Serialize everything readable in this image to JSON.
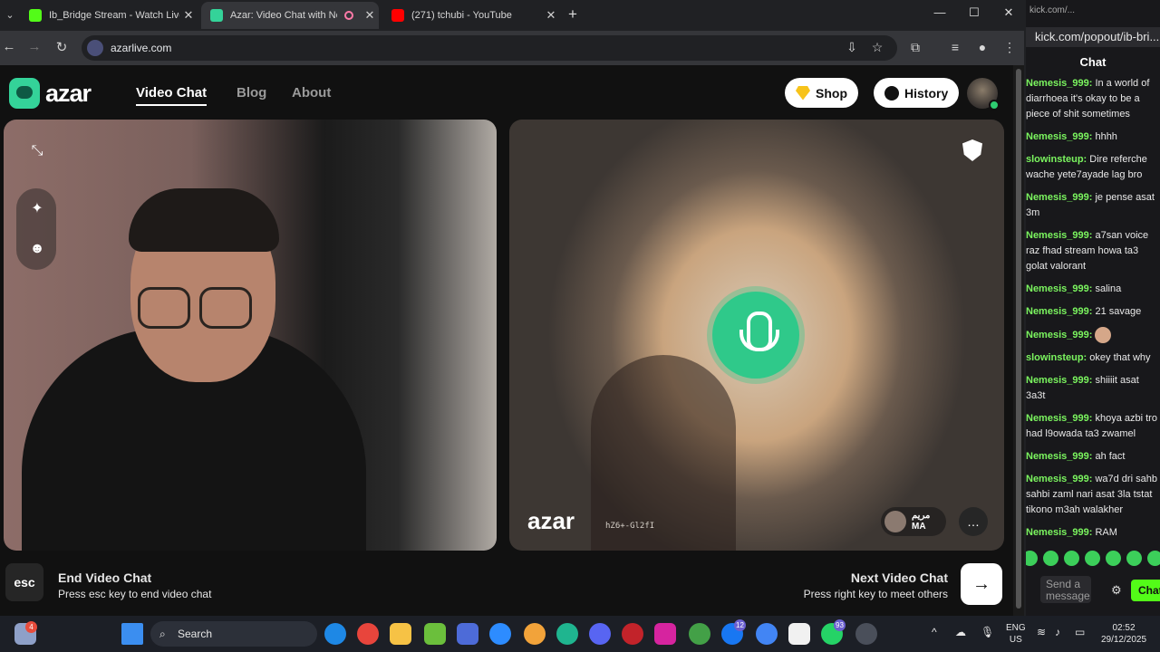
{
  "browser": {
    "tabs": [
      {
        "title": "Ib_Bridge Stream - Watch Live o",
        "fav_color": "#53fc18"
      },
      {
        "title": "Azar: Video Chat with New",
        "fav_color": "#34d399"
      },
      {
        "title": "(271) tchubi - YouTube",
        "fav_color": "#ff0000"
      }
    ],
    "url": "azarlive.com"
  },
  "azar": {
    "brand": "azar",
    "nav": [
      "Video Chat",
      "Blog",
      "About"
    ],
    "shop_label": "Shop",
    "history_label": "History",
    "watermark": "azar",
    "session_code": "hZ6+-Gl2fI",
    "partner_name": "مريم",
    "partner_country": "MA",
    "esc_label": "esc",
    "end_title": "End Video Chat",
    "end_sub": "Press esc key to end video chat",
    "next_title": "Next Video Chat",
    "next_sub": "Press right key to meet others",
    "next_icon": "→",
    "accent": "#34d399"
  },
  "chat": {
    "window_title": "kick.com/...",
    "url": "kick.com/popout/ib-bri...",
    "header": "Chat",
    "messages": [
      {
        "user": "Nemesis_999:",
        "text": "In a world of diarrhoea it's okay to be a piece of shit sometimes"
      },
      {
        "user": "Nemesis_999:",
        "text": "hhhh"
      },
      {
        "user": "slowinsteup:",
        "text": "Dire referche wache yete7ayade lag bro"
      },
      {
        "user": "Nemesis_999:",
        "text": "je pense asat 3m"
      },
      {
        "user": "Nemesis_999:",
        "text": "a7san voice raz fhad stream howa ta3 golat valorant"
      },
      {
        "user": "Nemesis_999:",
        "text": "salina"
      },
      {
        "user": "Nemesis_999:",
        "text": "21 savage"
      },
      {
        "user": "Nemesis_999:",
        "text": ""
      },
      {
        "user": "slowinsteup:",
        "text": "okey that why"
      },
      {
        "user": "Nemesis_999:",
        "text": "shiiiit asat 3a3t"
      },
      {
        "user": "Nemesis_999:",
        "text": "khoya azbi tro had l9owada ta3 zwamel"
      },
      {
        "user": "Nemesis_999:",
        "text": "ah fact"
      },
      {
        "user": "Nemesis_999:",
        "text": "wa7d dri sahb sahbi zaml nari asat 3la tstat tikono m3ah walakher"
      },
      {
        "user": "Nemesis_999:",
        "text": "RAM"
      }
    ],
    "input_placeholder": "Send a message",
    "send_label": "Chat"
  },
  "taskbar": {
    "search_label": "Search",
    "lang_top": "ENG",
    "lang_bottom": "US",
    "time": "02:52",
    "date": "29/12/2025",
    "badge_a": "4",
    "badge_b": "12",
    "badge_c": "93"
  }
}
